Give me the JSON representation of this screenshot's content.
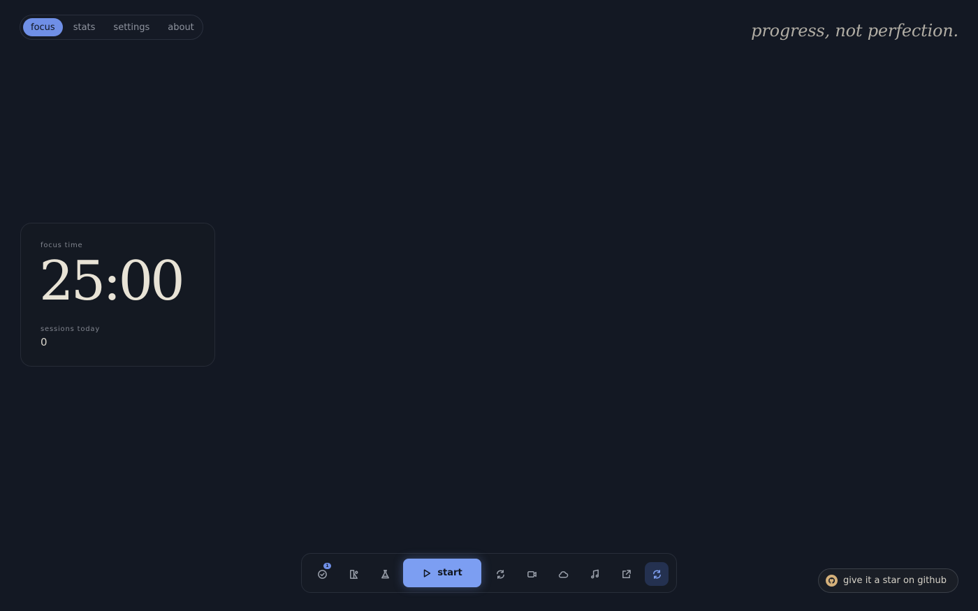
{
  "nav": {
    "items": [
      {
        "label": "focus",
        "active": true
      },
      {
        "label": "stats"
      },
      {
        "label": "settings"
      },
      {
        "label": "about"
      }
    ]
  },
  "quote": "progress, not perfection.",
  "timer_card": {
    "focus_label": "focus time",
    "time": "25:00",
    "sessions_label": "sessions today",
    "sessions_value": "0"
  },
  "toolbar": {
    "tasks_badge": "1",
    "start_label": "start",
    "icons": [
      "check-circle-icon",
      "shapes-icon",
      "flask-icon",
      "play-icon",
      "repeat-icon",
      "video-icon",
      "cloud-icon",
      "music-icon",
      "external-link-icon",
      "refresh-icon"
    ]
  },
  "github": {
    "label": "give it a star on github"
  },
  "colors": {
    "background": "#131823",
    "accent": "#7c9ef2",
    "text": "#e8e3d6"
  }
}
